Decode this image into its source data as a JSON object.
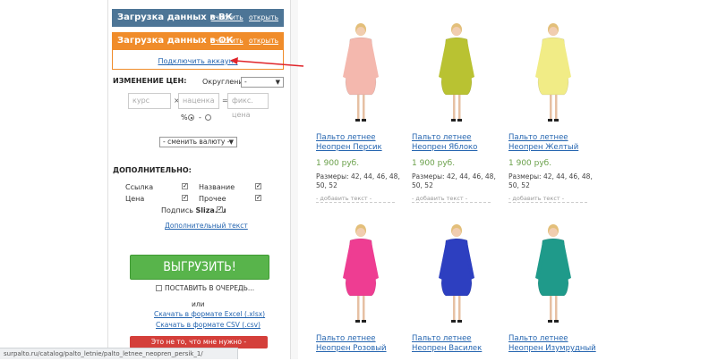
{
  "panel": {
    "vk": {
      "title": "Загрузка данных в ВК",
      "link_clear": "очистить",
      "link_open": "открыть"
    },
    "ok": {
      "title": "Загрузка данных в ОК",
      "link_clear": "очистить",
      "link_open": "открыть",
      "connect": "Подключить аккаунт"
    },
    "price_change": {
      "label": "ИЗМЕНЕНИЕ ЦЕН:",
      "rounding_label": "Округление",
      "rounding_value": "-",
      "rate_placeholder": "курс",
      "markup_placeholder": "наценка",
      "fixed_placeholder": "фикс. цена",
      "percent_label": "%",
      "minus_label": "-",
      "currency_select": "- сменить валюту -"
    },
    "extra": {
      "label": "ДОПОЛНИТЕЛЬНО:",
      "link_label": "Ссылка",
      "name_label": "Название",
      "price_label": "Цена",
      "other_label": "Прочее",
      "signature_prefix": "Подпись",
      "signature_brand": "Sliza.ru",
      "additional_text_link": "Дополнительный текст"
    },
    "export_button": "ВЫГРУЗИТЬ!",
    "queue_label": "ПОСТАВИТЬ В ОЧЕРЕДЬ...",
    "or_label": "или",
    "download_excel": "Скачать в формате Excel (.xlsx)",
    "download_csv": "Скачать в формате CSV (.csv)",
    "cancel_button": "Это не то, что мне нужно - ОТМЕНИТЬ!"
  },
  "status_url": "surpalto.ru/catalog/palto_letnie/palto_letnee_neopren_persik_1/",
  "products": [
    {
      "title_line1": "Пальто летнее",
      "title_line2": "Неопрен Персик",
      "price": "1 900 руб.",
      "sizes": "Размеры: 42, 44, 46, 48, 50, 52",
      "add_text": "- добавить текст -",
      "coat_color": "#f4b8ae"
    },
    {
      "title_line1": "Пальто летнее",
      "title_line2": "Неопрен Яблоко",
      "price": "1 900 руб.",
      "sizes": "Размеры: 42, 44, 46, 48, 50, 52",
      "add_text": "- добавить текст -",
      "coat_color": "#b9c232"
    },
    {
      "title_line1": "Пальто летнее",
      "title_line2": "Неопрен Желтый",
      "price": "1 900 руб.",
      "sizes": "Размеры: 42, 44, 46, 48, 50, 52",
      "add_text": "- добавить текст -",
      "coat_color": "#f1ec86"
    },
    {
      "title_line1": "Пальто летнее",
      "title_line2": "Неопрен Розовый",
      "coat_color": "#ee3d92"
    },
    {
      "title_line1": "Пальто летнее",
      "title_line2": "Неопрен Василек",
      "coat_color": "#2d3fc0"
    },
    {
      "title_line1": "Пальто летнее",
      "title_line2": "Неопрен Изумрудный",
      "coat_color": "#1f9a8a"
    }
  ],
  "colors": {
    "vk_header": "#4d7596",
    "ok_header": "#f08c2a",
    "export": "#58b44b",
    "cancel": "#d43f3a",
    "link": "#2565b0",
    "price": "#6aa04a"
  }
}
